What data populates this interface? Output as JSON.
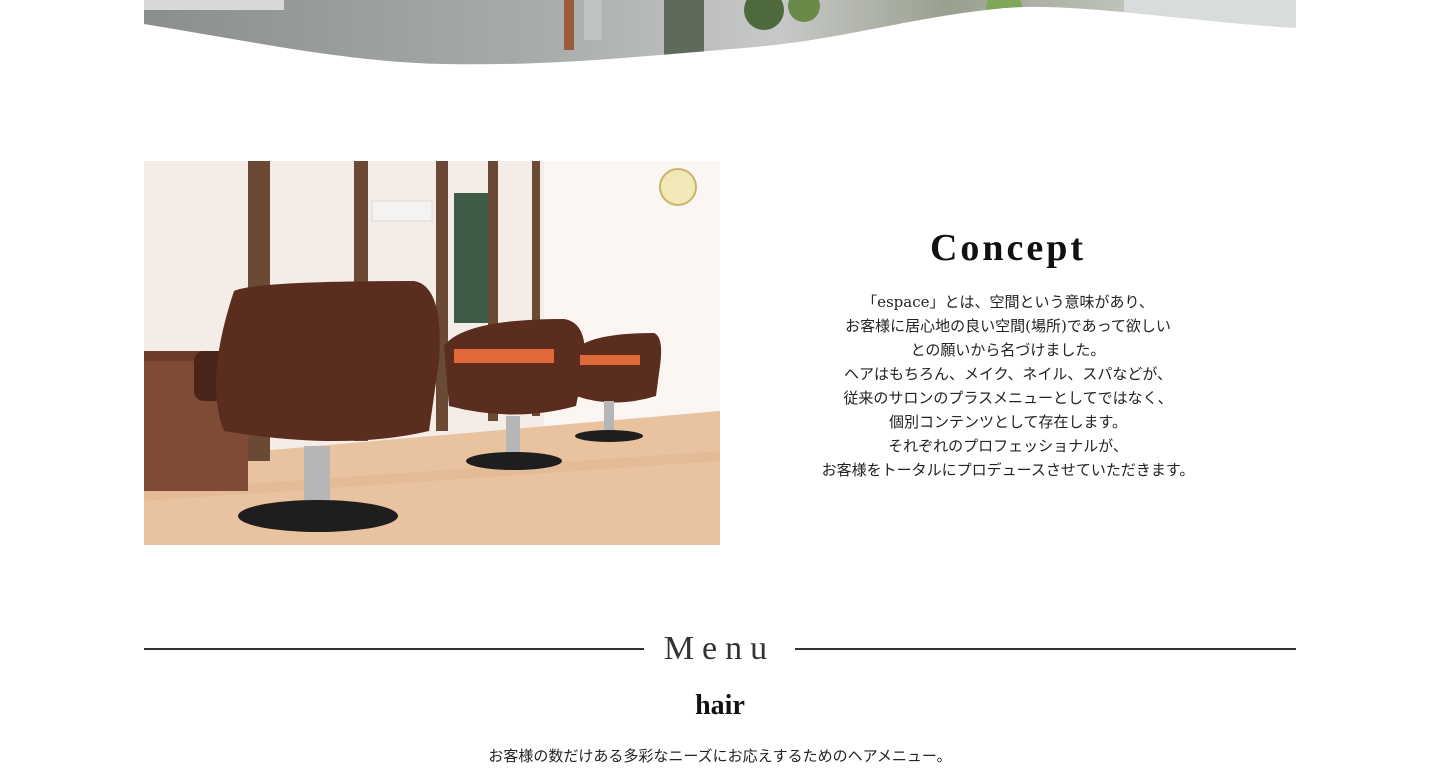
{
  "concept": {
    "title": "Concept",
    "lines": [
      "「espace」とは、空間という意味があり、",
      "お客様に居心地の良い空間(場所)であって欲しい",
      "との願いから名づけました。",
      "ヘアはもちろん、メイク、ネイル、スパなどが、",
      "従来のサロンのプラスメニューとしてではなく、",
      "個別コンテンツとして存在します。",
      "それぞれのプロフェッショナルが、",
      "お客様をトータルにプロデュースさせていただきます。"
    ]
  },
  "menu": {
    "title": "Menu",
    "hair": {
      "title": "hair",
      "description": "お客様の数だけある多彩なニーズにお応えするためのヘアメニュー。"
    }
  },
  "colors": {
    "rule": "#333333",
    "background": "#ffffff"
  }
}
